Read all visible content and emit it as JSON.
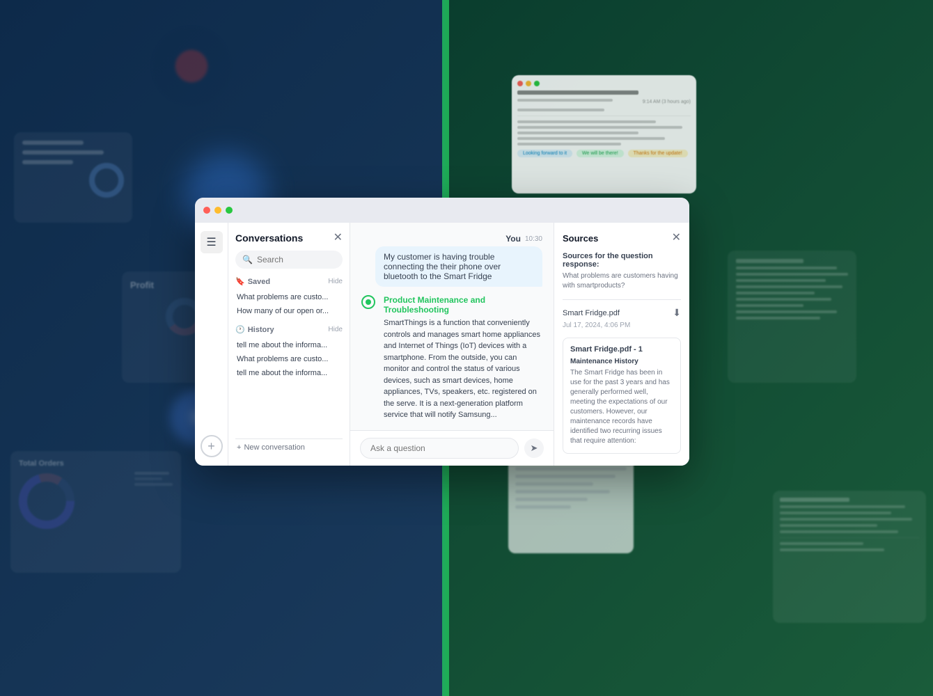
{
  "background": {
    "left_color": "#0d2a4a",
    "right_color": "#0a3d2e",
    "divider_color": "#22c55e"
  },
  "sidebar": {
    "icons": [
      "≡",
      "+"
    ]
  },
  "conversations": {
    "title": "Conversations",
    "close_label": "✕",
    "search_placeholder": "Search",
    "saved_label": "Saved",
    "saved_hide": "Hide",
    "saved_items": [
      "What problems are custo...",
      "How many of our open or..."
    ],
    "history_label": "History",
    "history_hide": "Hide",
    "history_items": [
      "tell me about the informa...",
      "What problems are custo...",
      "tell me about the informa..."
    ],
    "new_conversation_label": "New conversation"
  },
  "chat": {
    "user_name": "You",
    "timestamp": "10:30",
    "user_message": "My customer is having trouble connecting the their phone over bluetooth to the Smart Fridge",
    "ai_title": "Product Maintenance and Troubleshooting",
    "ai_message": "SmartThings is a function that conveniently controls and manages smart home appliances and Internet of Things (IoT) devices with a smartphone. From the outside, you can monitor and control the status of various devices, such as smart devices, home appliances, TVs, speakers, etc. registered on the serve. It is a next-generation platform service that will notify Samsung...",
    "input_placeholder": "Ask a question",
    "send_icon": "➤"
  },
  "sources": {
    "title": "Sources",
    "close_label": "✕",
    "question_label": "Sources for the question response:",
    "question_text": "What problems are customers having with smartproducts?",
    "file_name": "Smart Fridge.pdf",
    "file_date": "Jul 17, 2024, 4:06 PM",
    "download_icon": "⬇",
    "card_title": "Smart Fridge.pdf - 1",
    "card_subtitle": "Maintenance History",
    "card_text": "The Smart Fridge has been in use for the past 3 years and has generally performed well, meeting the expectations of our customers. However, our maintenance records have identified two recurring issues that require attention:"
  },
  "profit_widget": {
    "label": "Profit"
  },
  "total_orders_widget": {
    "label": "Total Orders"
  }
}
